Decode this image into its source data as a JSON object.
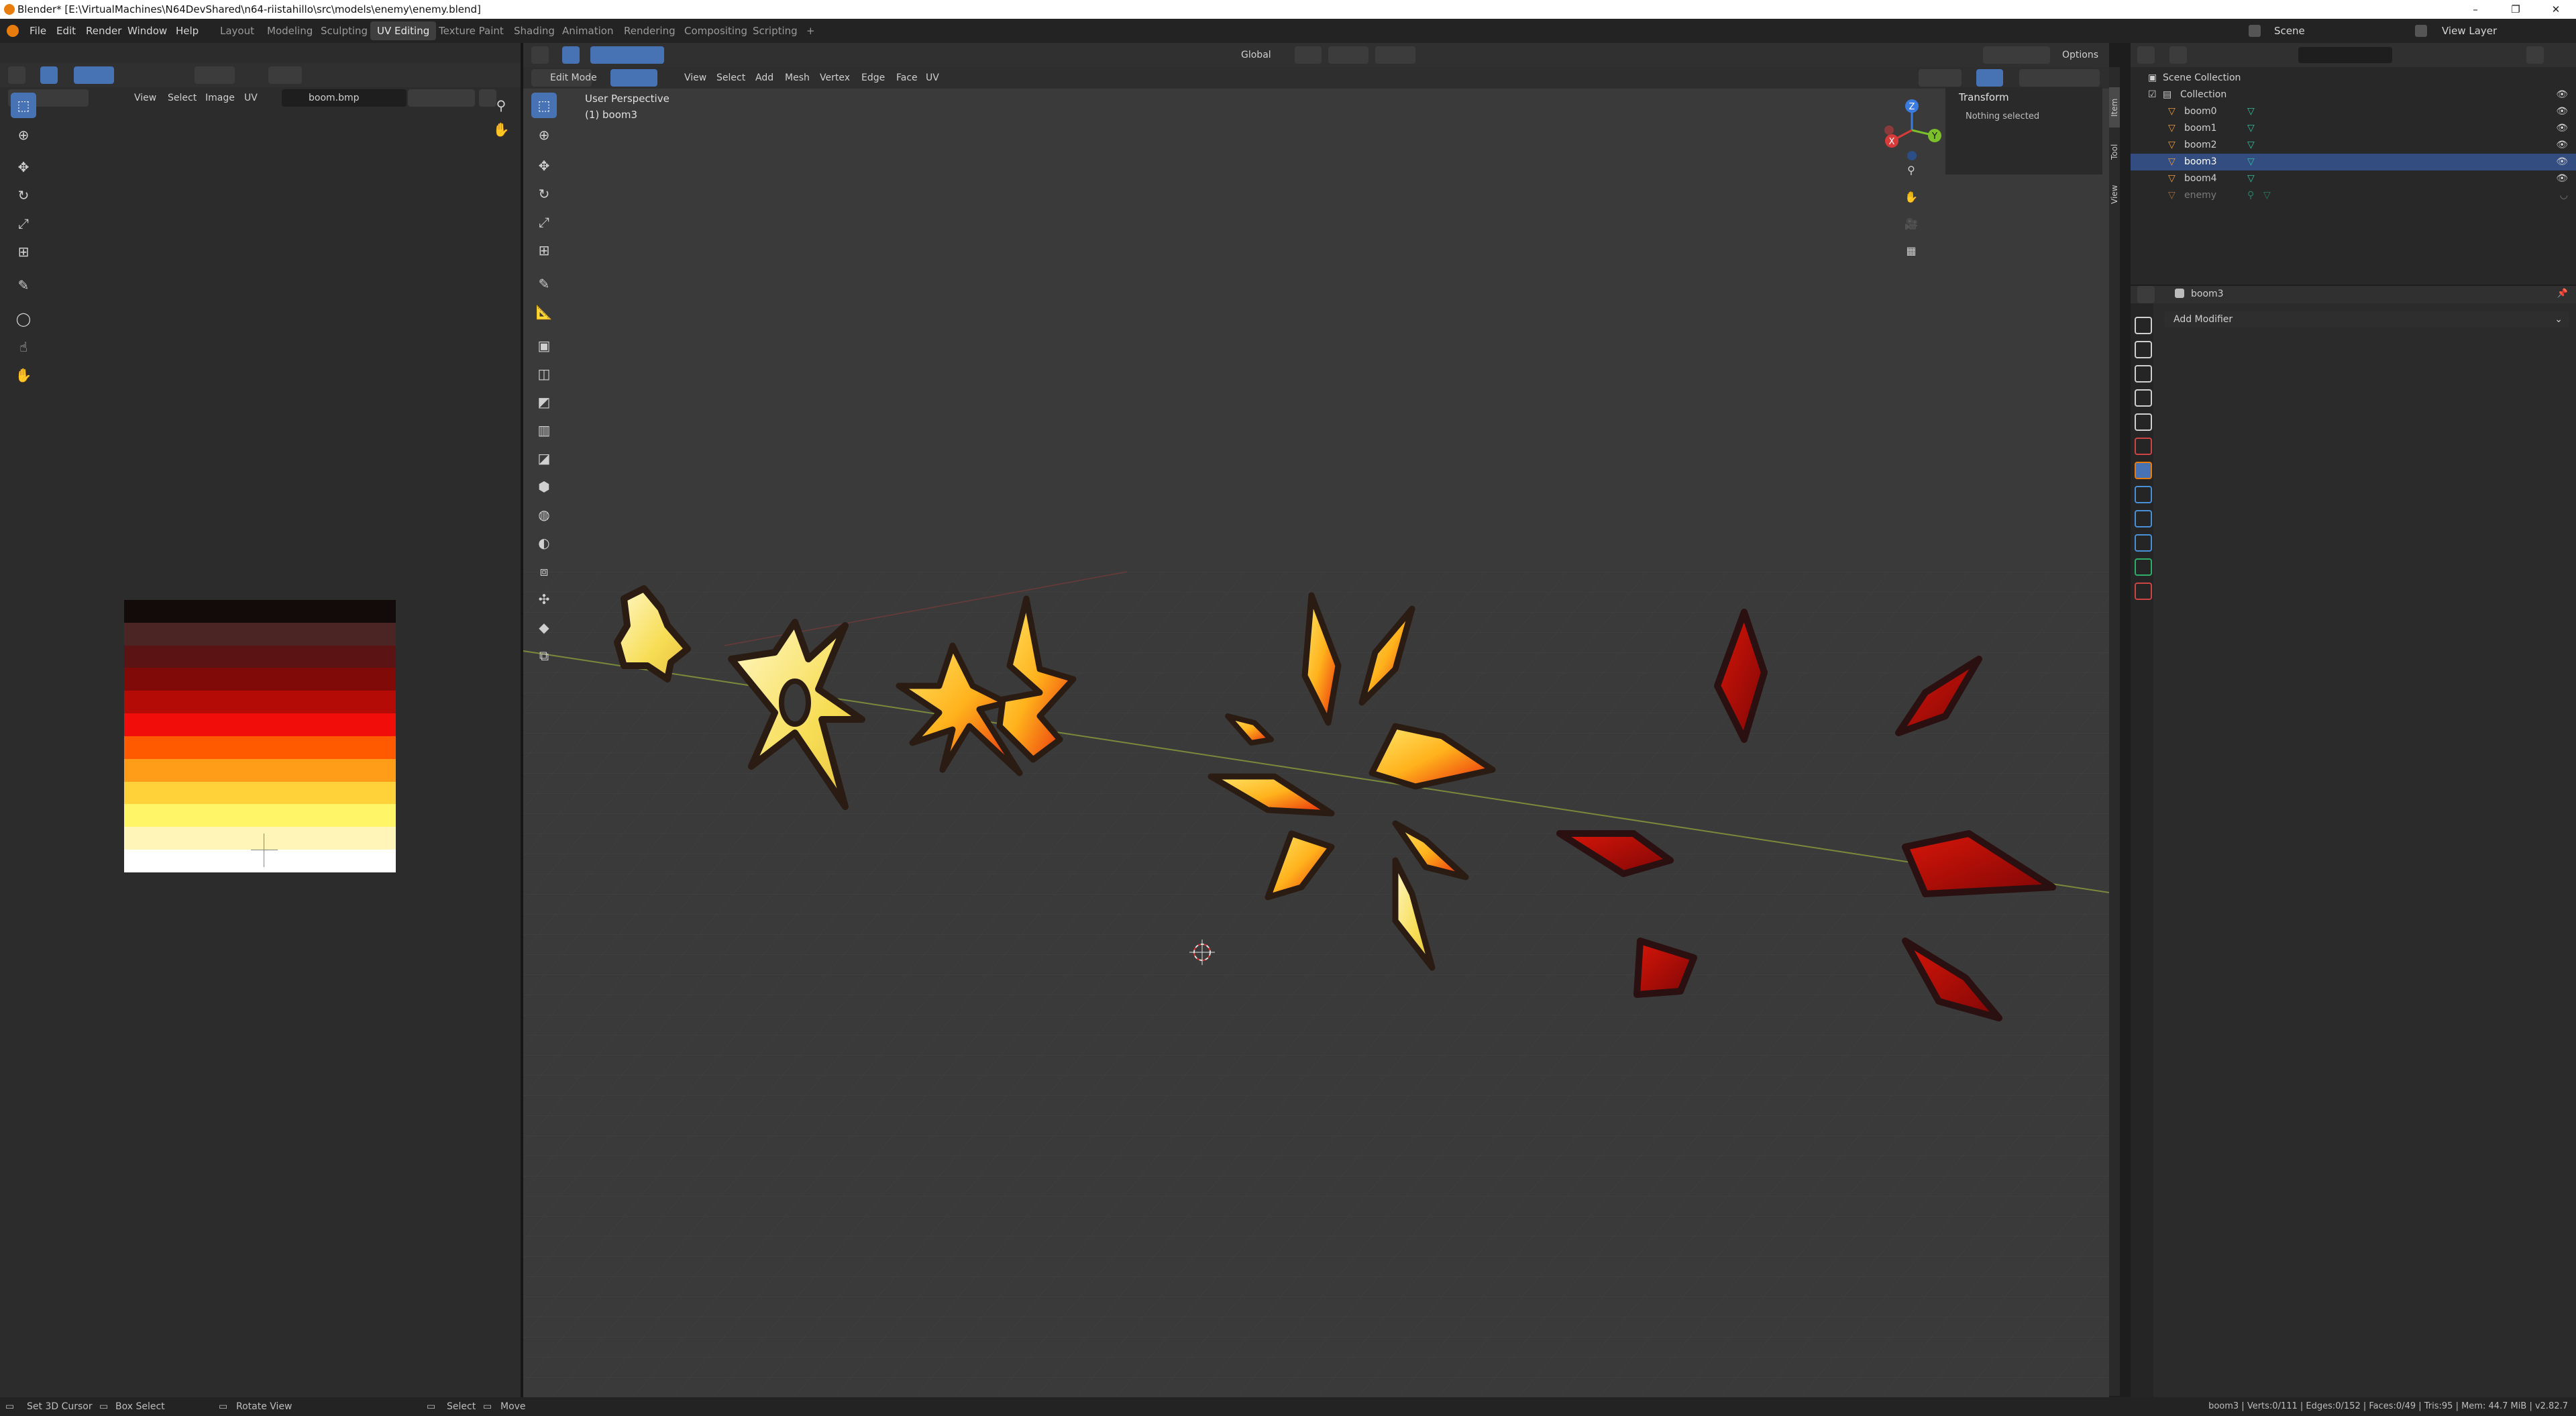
{
  "window": {
    "title": "Blender* [E:\\VirtualMachines\\N64DevShared\\n64-riistahillo\\src\\models\\enemy\\enemy.blend]",
    "buttons": [
      "–",
      "❐",
      "✕"
    ]
  },
  "top_menu": [
    "File",
    "Edit",
    "Render",
    "Window",
    "Help"
  ],
  "workspaces": [
    "Layout",
    "Modeling",
    "Sculpting",
    "UV Editing",
    "Texture Paint",
    "Shading",
    "Animation",
    "Rendering",
    "Compositing",
    "Scripting",
    "+"
  ],
  "active_workspace": "UV Editing",
  "scene": {
    "label": "Scene",
    "view_layer": "View Layer"
  },
  "uv_editor": {
    "menus": [
      "View",
      "Select",
      "Image",
      "UV"
    ],
    "image_name": "boom.bmp",
    "texture_colors": [
      "#130a0a",
      "#4a2523",
      "#5c1313",
      "#7f0a08",
      "#b50b06",
      "#f10d09",
      "#ff5a00",
      "#ff9c18",
      "#ffd23a",
      "#fff566",
      "#fff5b8",
      "#ffffff"
    ]
  },
  "viewport": {
    "mode": "Edit Mode",
    "menus": [
      "View",
      "Select",
      "Add",
      "Mesh",
      "Vertex",
      "Edge",
      "Face",
      "UV"
    ],
    "orientation": "Global",
    "options_label": "Options",
    "perspective": "User Perspective",
    "object": "(1) boom3",
    "axis_labels": [
      "X",
      "Y",
      "Z"
    ],
    "sidebar_tabs": [
      "Item",
      "Tool",
      "View"
    ],
    "transform_title": "Transform",
    "transform_status": "Nothing selected"
  },
  "outliner": {
    "root": "Scene Collection",
    "collection": "Collection",
    "objects": [
      {
        "name": "boom0",
        "selected": false,
        "dim": false
      },
      {
        "name": "boom1",
        "selected": false,
        "dim": false
      },
      {
        "name": "boom2",
        "selected": false,
        "dim": false
      },
      {
        "name": "boom3",
        "selected": true,
        "dim": false
      },
      {
        "name": "boom4",
        "selected": false,
        "dim": false
      },
      {
        "name": "enemy",
        "selected": false,
        "dim": true
      }
    ]
  },
  "properties": {
    "object_name": "boom3",
    "add_modifier": "Add Modifier",
    "tab_colors": [
      "#d0d0d0",
      "#d0d0d0",
      "#d0d0d0",
      "#d0d0d0",
      "#d0d0d0",
      "#c44",
      "#e87d0d",
      "#4a90d9",
      "#4a90d9",
      "#4a90d9",
      "#2fae6a",
      "#c44"
    ]
  },
  "status": {
    "items": [
      "Set 3D Cursor",
      "Box Select",
      "Rotate View",
      "Select",
      "Move"
    ],
    "stats": "boom3 | Verts:0/111 | Edges:0/152 | Faces:0/49 | Tris:95 | Mem: 44.7 MiB | v2.82.7"
  }
}
